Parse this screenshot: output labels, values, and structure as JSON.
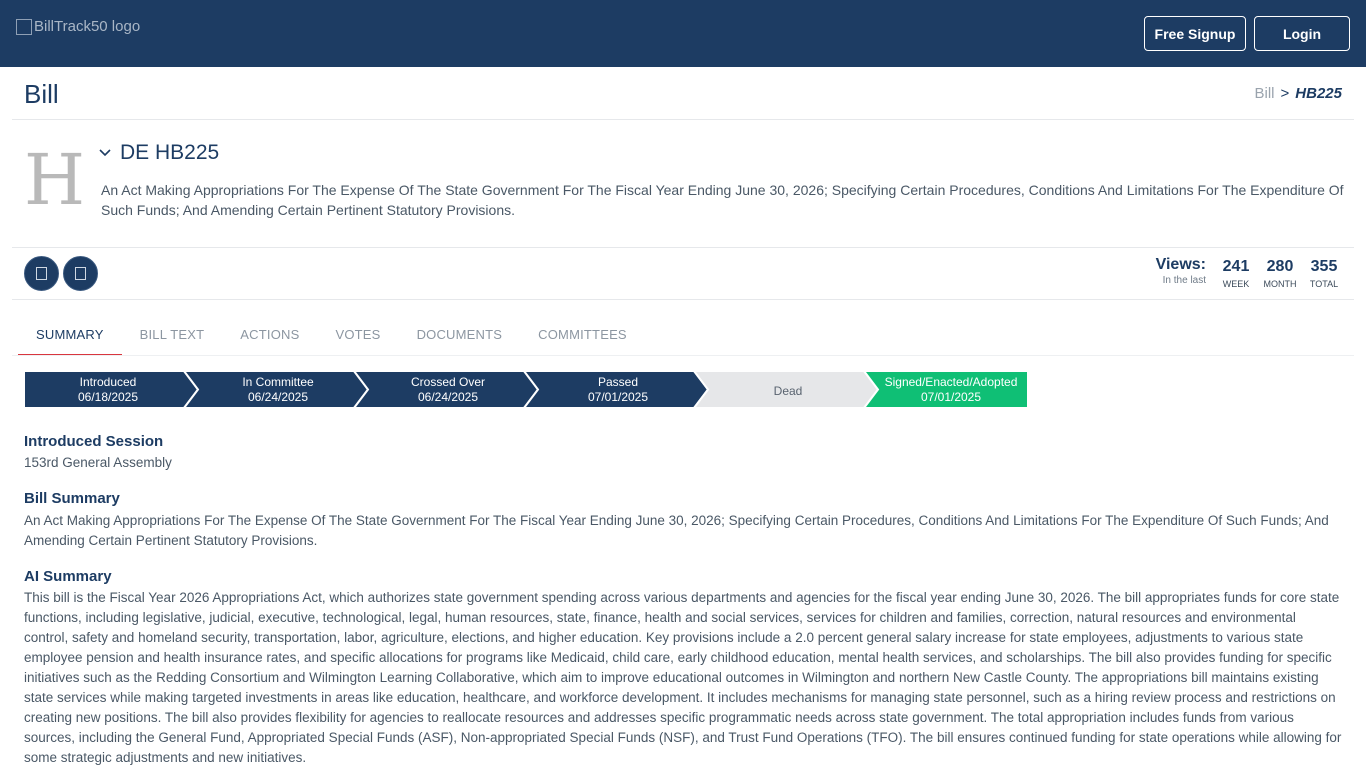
{
  "header": {
    "logo_alt": "BillTrack50 logo",
    "signup_label": "Free Signup",
    "login_label": "Login"
  },
  "page": {
    "title": "Bill",
    "breadcrumb": {
      "parent": "Bill",
      "separator": ">",
      "current": "HB225"
    }
  },
  "bill": {
    "state_letter": "H",
    "id": "DE HB225",
    "description": "An Act Making Appropriations For The Expense Of The State Government For The Fiscal Year Ending June 30, 2026; Specifying Certain Procedures, Conditions And Limitations For The Expenditure Of Such Funds; And Amending Certain Pertinent Statutory Provisions."
  },
  "views": {
    "title": "Views:",
    "subtitle": "In the last",
    "stats": [
      {
        "value": "241",
        "label": "WEEK"
      },
      {
        "value": "280",
        "label": "MONTH"
      },
      {
        "value": "355",
        "label": "TOTAL"
      }
    ]
  },
  "tabs": [
    "SUMMARY",
    "BILL TEXT",
    "ACTIONS",
    "VOTES",
    "DOCUMENTS",
    "COMMITTEES"
  ],
  "active_tab": "SUMMARY",
  "progress": {
    "colors": {
      "done": "#1d3c63",
      "dead": "#e6e7e9",
      "signed": "#0fbf75"
    },
    "steps": [
      {
        "label": "Introduced",
        "date": "06/18/2025",
        "status": "done"
      },
      {
        "label": "In Committee",
        "date": "06/24/2025",
        "status": "done"
      },
      {
        "label": "Crossed Over",
        "date": "06/24/2025",
        "status": "done"
      },
      {
        "label": "Passed",
        "date": "07/01/2025",
        "status": "done"
      },
      {
        "label": "Dead",
        "date": "",
        "status": "dead"
      },
      {
        "label": "Signed/Enacted/Adopted",
        "date": "07/01/2025",
        "status": "signed"
      }
    ]
  },
  "summary": {
    "session_heading": "Introduced Session",
    "session_value": "153rd General Assembly",
    "bill_summary_heading": "Bill Summary",
    "bill_summary_text": "An Act Making Appropriations For The Expense Of The State Government For The Fiscal Year Ending June 30, 2026; Specifying Certain Procedures, Conditions And Limitations For The Expenditure Of Such Funds; And Amending Certain Pertinent Statutory Provisions.",
    "ai_summary_heading": "AI Summary",
    "ai_summary_text": "This bill is the Fiscal Year 2026 Appropriations Act, which authorizes state government spending across various departments and agencies for the fiscal year ending June 30, 2026. The bill appropriates funds for core state functions, including legislative, judicial, executive, technological, legal, human resources, state, finance, health and social services, services for children and families, correction, natural resources and environmental control, safety and homeland security, transportation, labor, agriculture, elections, and higher education. Key provisions include a 2.0 percent general salary increase for state employees, adjustments to various state employee pension and health insurance rates, and specific allocations for programs like Medicaid, child care, early childhood education, mental health services, and scholarships. The bill also provides funding for specific initiatives such as the Redding Consortium and Wilmington Learning Collaborative, which aim to improve educational outcomes in Wilmington and northern New Castle County. The appropriations bill maintains existing state services while making targeted investments in areas like education, healthcare, and workforce development. It includes mechanisms for managing state personnel, such as a hiring review process and restrictions on creating new positions. The bill also provides flexibility for agencies to reallocate resources and addresses specific programmatic needs across state government. The total appropriation includes funds from various sources, including the General Fund, Appropriated Special Funds (ASF), Non-appropriated Special Funds (NSF), and Trust Fund Operations (TFO). The bill ensures continued funding for state operations while allowing for some strategic adjustments and new initiatives."
  }
}
